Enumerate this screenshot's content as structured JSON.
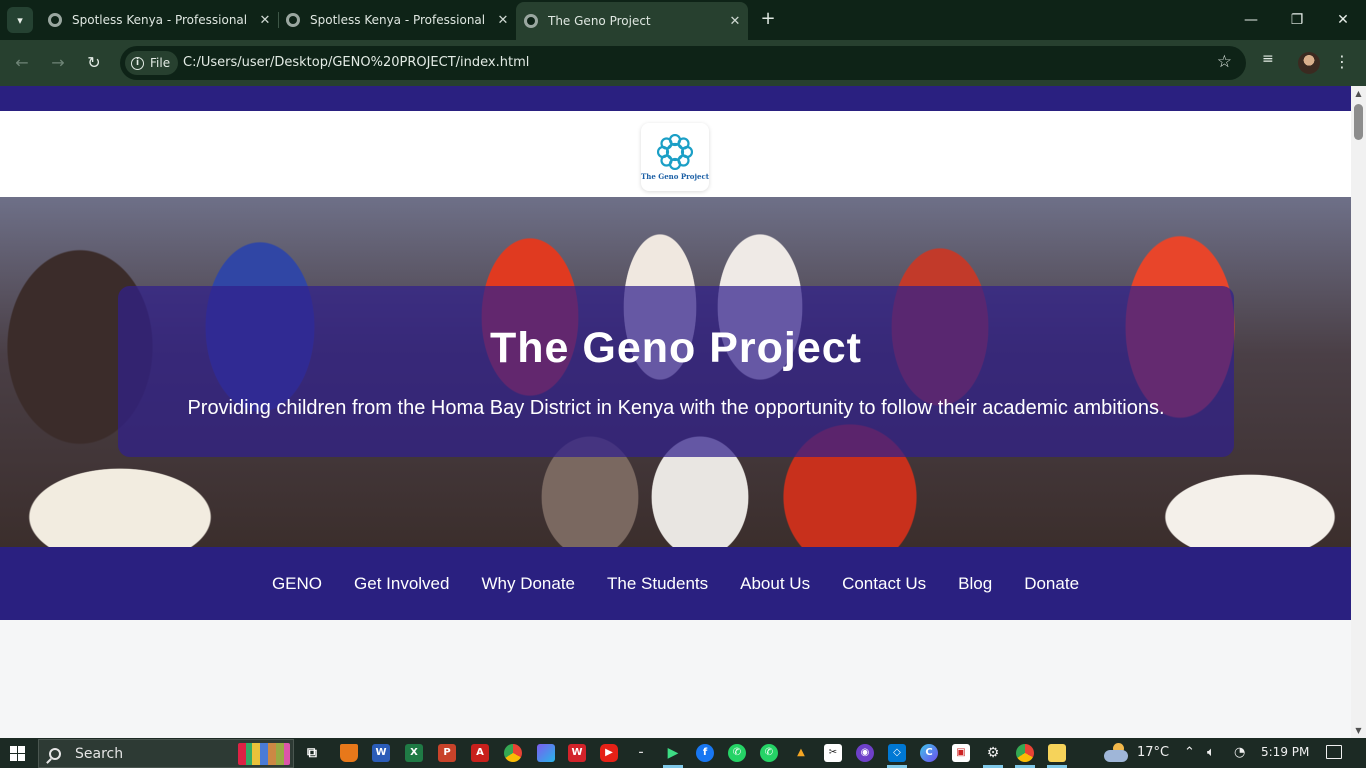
{
  "browser": {
    "tabs": [
      {
        "title": "Spotless Kenya - Professional Cl",
        "active": false
      },
      {
        "title": "Spotless Kenya - Professional Cl",
        "active": false
      },
      {
        "title": "The Geno Project",
        "active": true
      }
    ],
    "site_chip": "File",
    "url": "C:/Users/user/Desktop/GENO%20PROJECT/index.html"
  },
  "page": {
    "logo_text": "The Geno Project",
    "hero_title": "The Geno Project",
    "hero_subtitle": "Providing children from the Homa Bay District in Kenya with the opportunity to follow their academic ambitions.",
    "nav": [
      "GENO",
      "Get Involved",
      "Why Donate",
      "The Students",
      "About Us",
      "Contact Us",
      "Blog",
      "Donate"
    ],
    "colors": {
      "brand": "#2a2080",
      "overlay": "#30208c",
      "logo_blue": "#1b9fc6"
    }
  },
  "taskbar": {
    "search_placeholder": "Search",
    "temperature": "17°C",
    "time": "5:19 PM"
  }
}
